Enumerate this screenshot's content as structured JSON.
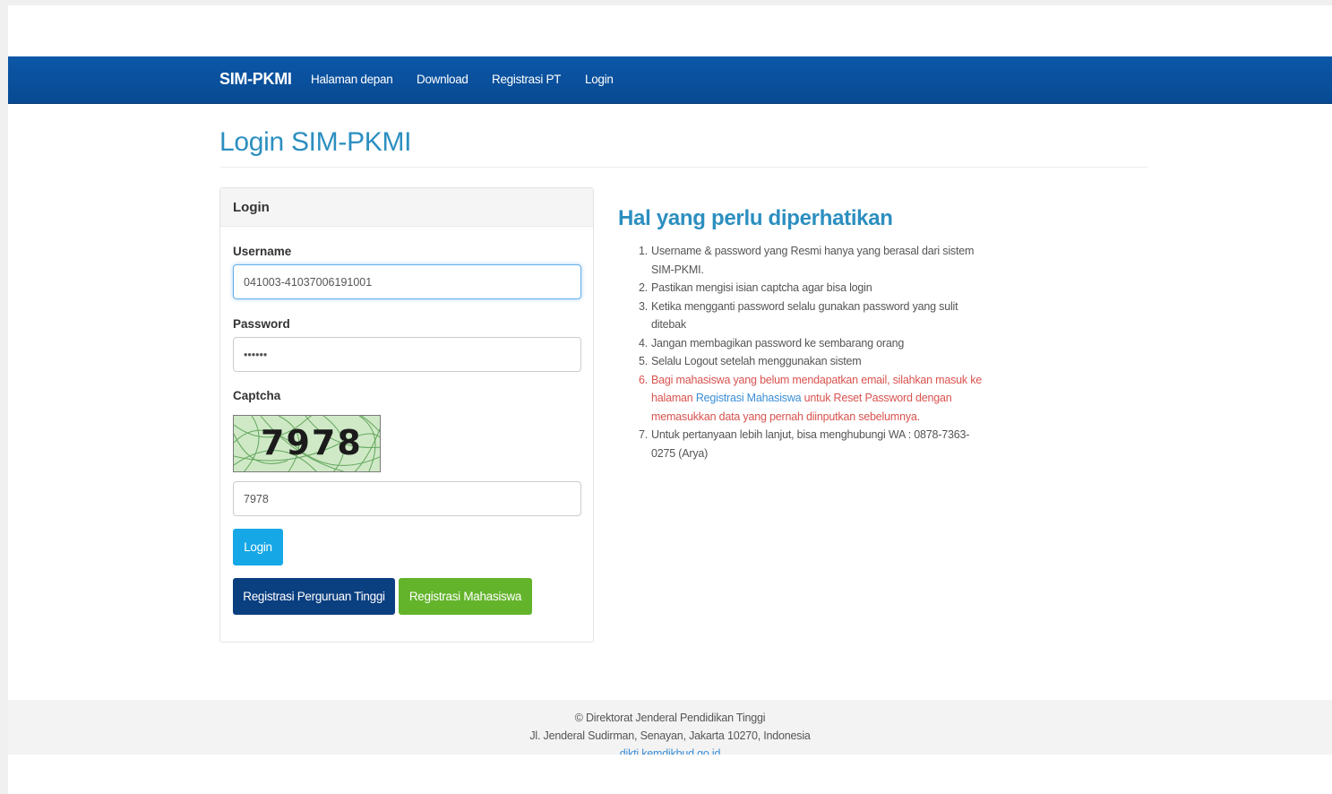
{
  "navbar": {
    "brand": "SIM-PKMI",
    "links": [
      "Halaman depan",
      "Download",
      "Registrasi PT",
      "Login"
    ]
  },
  "page_title": "Login SIM-PKMI",
  "login_panel": {
    "heading": "Login",
    "username_label": "Username",
    "username_value": "041003-41037006191001",
    "password_label": "Password",
    "password_value": "••••••",
    "captcha_label": "Captcha",
    "captcha_image_text": "7978",
    "captcha_value": "7978",
    "login_button": "Login",
    "register_pt_button": "Registrasi Perguruan Tinggi",
    "register_student_button": "Registrasi Mahasiswa"
  },
  "notes": {
    "title": "Hal yang perlu diperhatikan",
    "items": [
      "Username & password yang Resmi hanya yang berasal dari sistem SIM-PKMI.",
      "Pastikan mengisi isian captcha agar bisa login",
      "Ketika mengganti password selalu gunakan password yang sulit ditebak",
      "Jangan membagikan password ke sembarang orang",
      "Selalu Logout setelah menggunakan sistem",
      {
        "before": "Bagi mahasiswa yang belum mendapatkan email, silahkan masuk ke halaman ",
        "link": "Registrasi Mahasiswa",
        "after": " untuk Reset Password dengan memasukkan data yang pernah diinputkan sebelumnya."
      },
      "Untuk pertanyaan lebih lanjut, bisa menghubungi WA : 0878-7363-0275 (Arya)"
    ]
  },
  "footer": {
    "line1": "© Direktorat Jenderal Pendidikan Tinggi",
    "line2": "Jl. Jenderal Sudirman, Senayan, Jakarta 10270, Indonesia",
    "link": "dikti.kemdikbud.go.id"
  },
  "colors": {
    "navbar": "#0a52a0",
    "title": "#2c8fc0",
    "login_button": "#16a7e6",
    "register_pt_button": "#0a3f80",
    "register_student_button": "#63b42b",
    "warning_text": "#d9534f"
  }
}
